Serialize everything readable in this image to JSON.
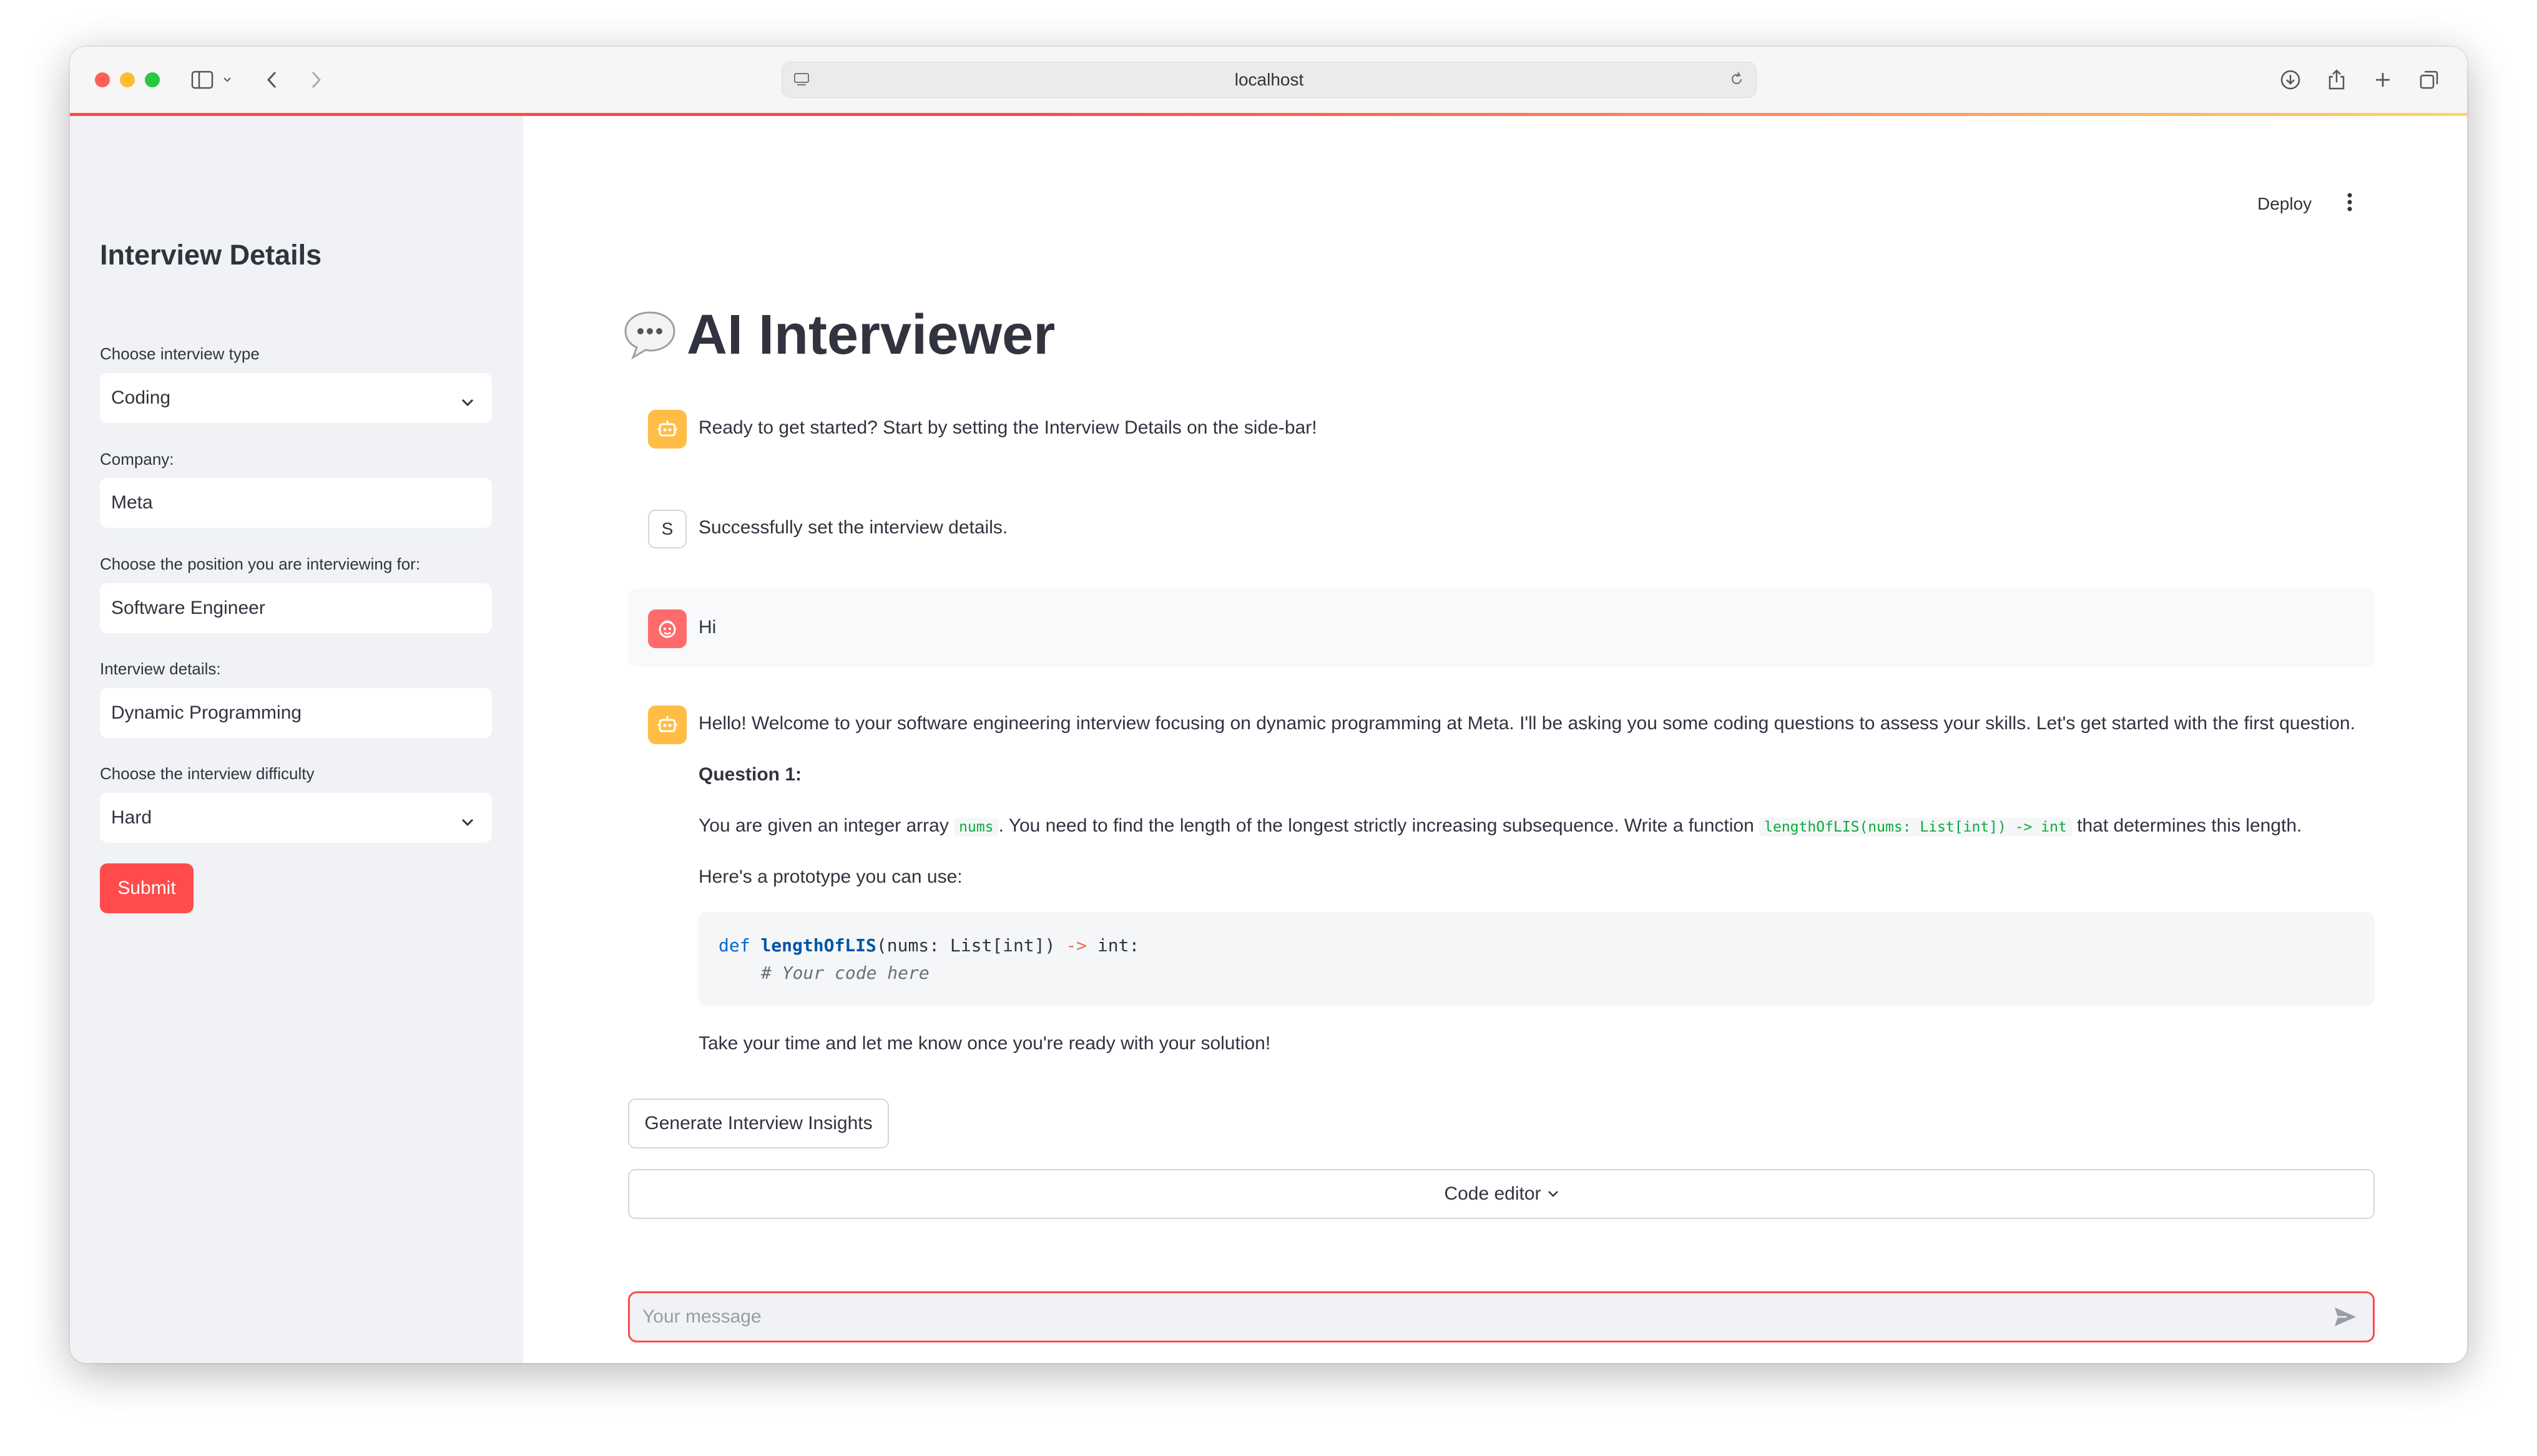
{
  "browser": {
    "url": "localhost"
  },
  "sidebar": {
    "title": "Interview Details",
    "fields": [
      {
        "label": "Choose interview type",
        "value": "Coding",
        "type": "select"
      },
      {
        "label": "Company:",
        "value": "Meta",
        "type": "text"
      },
      {
        "label": "Choose the position you are interviewing for:",
        "value": "Software Engineer",
        "type": "text"
      },
      {
        "label": "Interview details:",
        "value": "Dynamic Programming",
        "type": "text"
      },
      {
        "label": "Choose the interview difficulty",
        "value": "Hard",
        "type": "select"
      }
    ],
    "submit_label": "Submit"
  },
  "header": {
    "deploy_label": "Deploy"
  },
  "main": {
    "title": "AI Interviewer",
    "messages": [
      {
        "role": "assistant",
        "text": "Ready to get started? Start by setting the Interview Details on the side-bar!"
      },
      {
        "role": "system",
        "avatar_letter": "S",
        "text": "Successfully set the interview details."
      },
      {
        "role": "user",
        "text": "Hi"
      },
      {
        "role": "assistant",
        "intro": "Hello! Welcome to your software engineering interview focusing on dynamic programming at Meta. I'll be asking you some coding questions to assess your skills. Let's get started with the first question.",
        "question_heading": "Question 1:",
        "q_part1": "You are given an integer array",
        "q_code1": "nums",
        "q_part2": ". You need to find the length of the longest strictly increasing subsequence. Write a function",
        "q_code2": "lengthOfLIS(nums: List[int]) -> int",
        "q_part3": "that determines this length.",
        "prototype_text": "Here's a prototype you can use:",
        "code_kw": "def",
        "code_fn": "lengthOfLIS",
        "code_p1": "(nums: List[int]) ",
        "code_arrow": "->",
        "code_ret": " int:",
        "code_comment": "# Your code here",
        "outro": "Take your time and let me know once you're ready with your solution!"
      }
    ],
    "insights_button": "Generate Interview Insights",
    "code_editor_label": "Code editor",
    "chat_placeholder": "Your message"
  },
  "colors": {
    "accent": "#ff4b4b",
    "sidebar_bg": "#f0f2f6",
    "assistant_avatar": "#ffbd45",
    "user_avatar": "#ff6b6b",
    "inline_code": "#09ab3b"
  }
}
